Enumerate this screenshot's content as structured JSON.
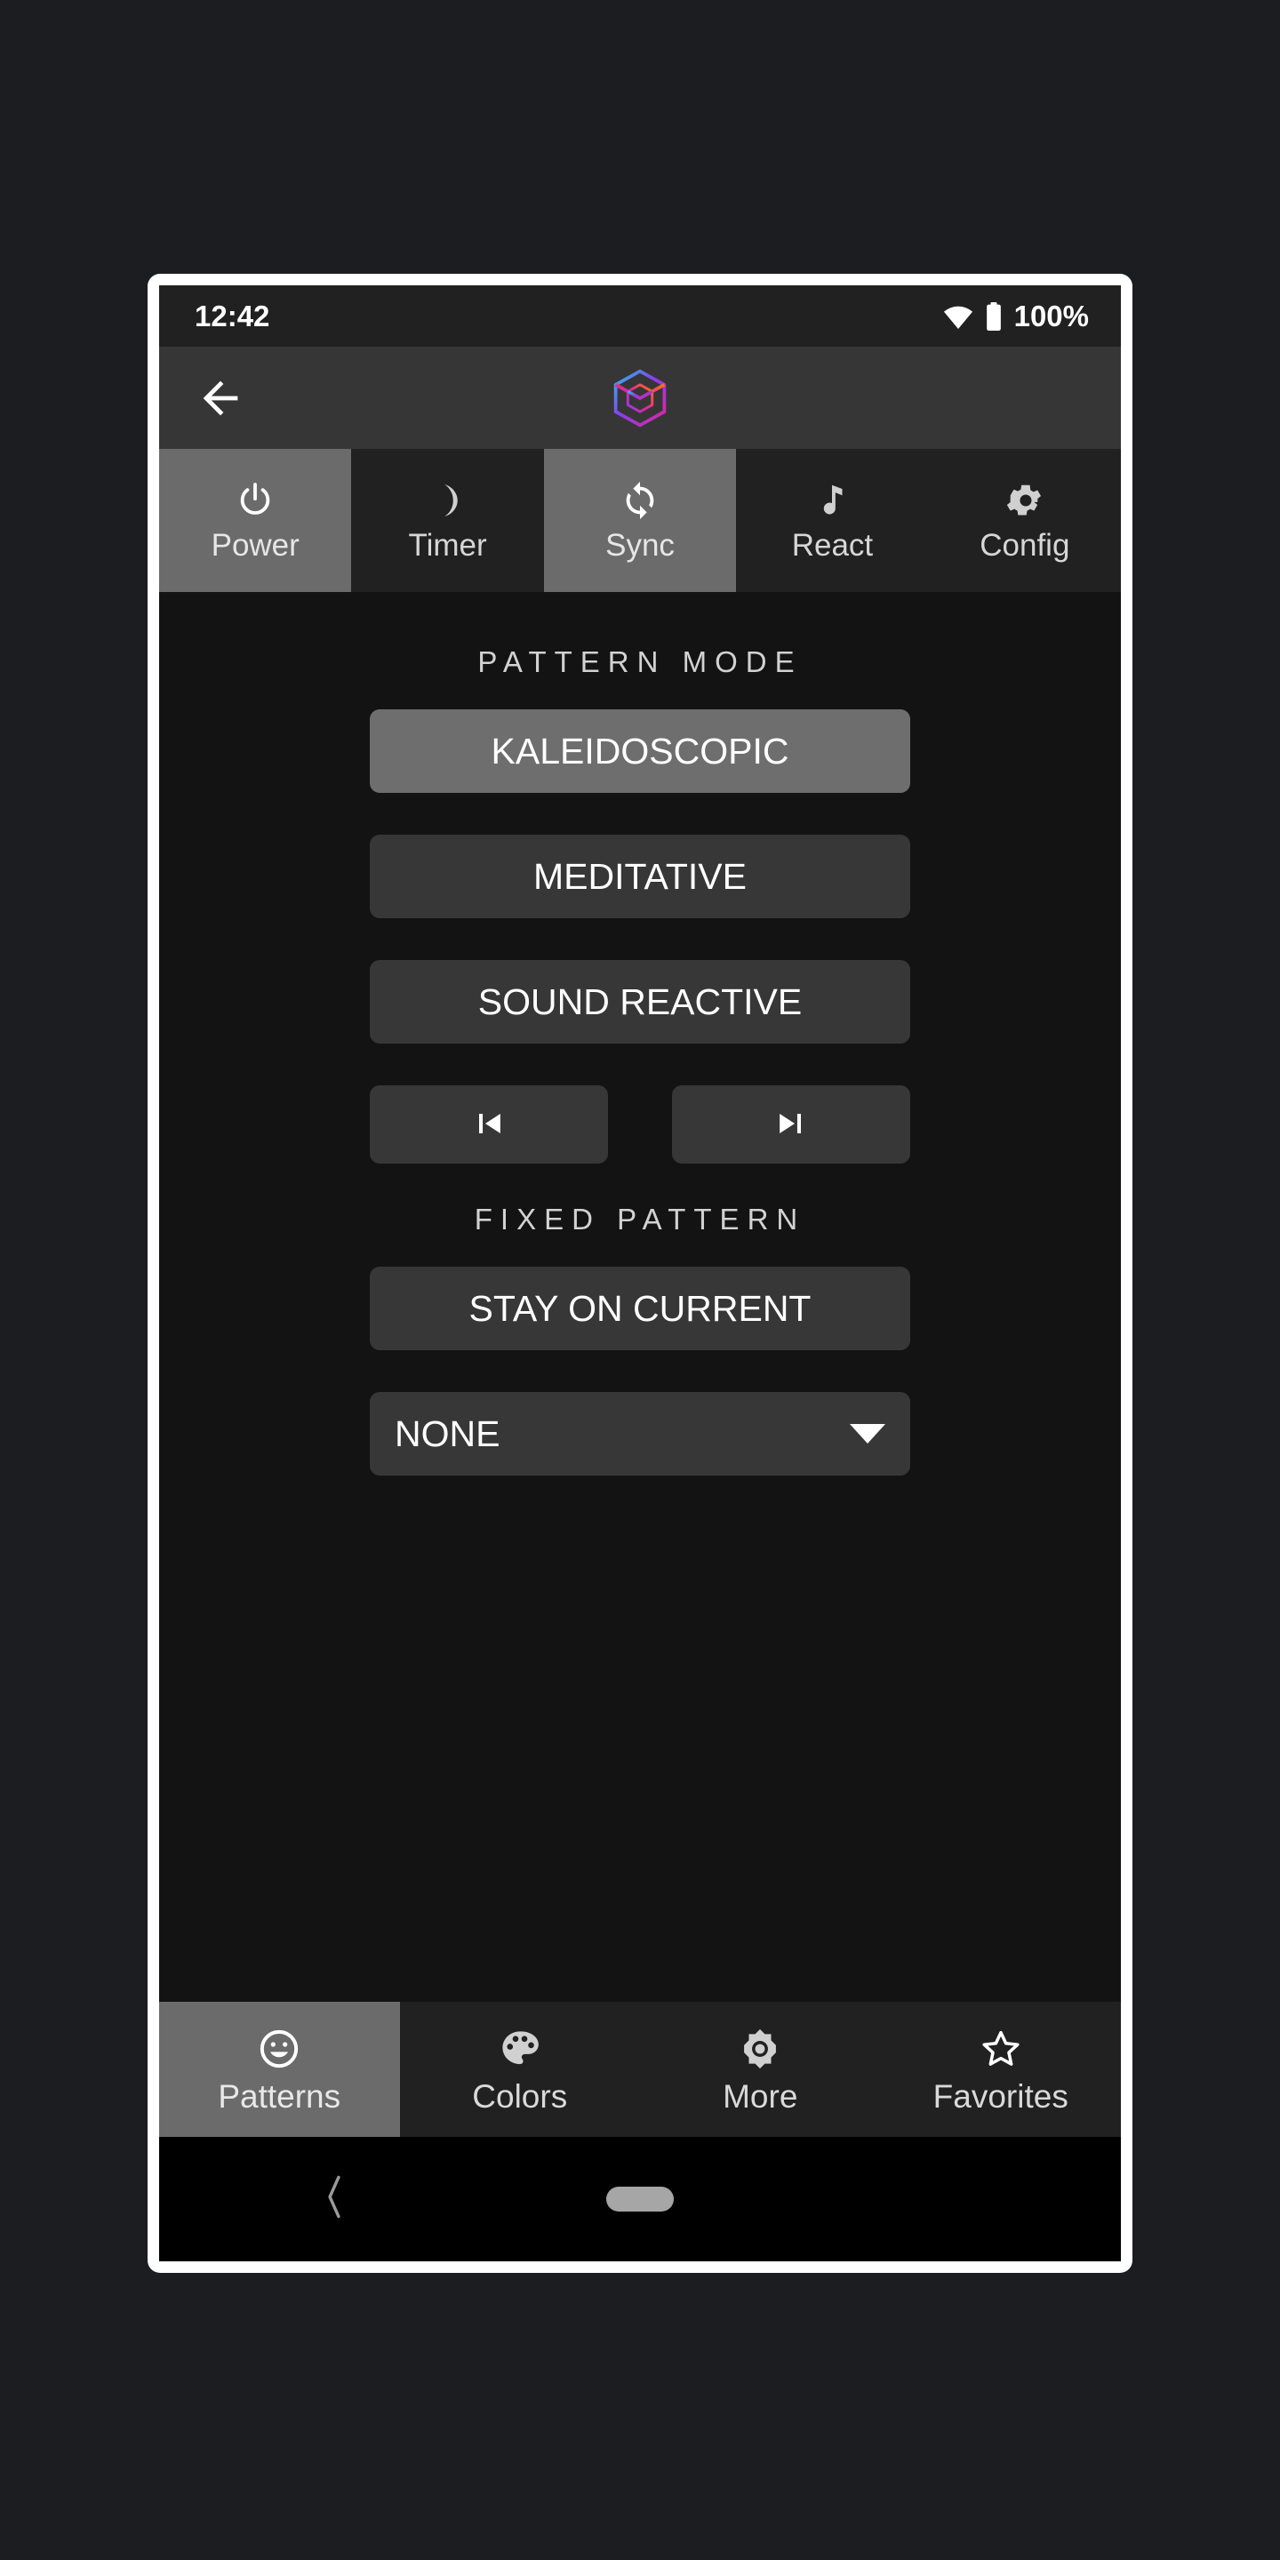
{
  "status_bar": {
    "time": "12:42",
    "battery_percent": "100%",
    "wifi_icon": "wifi-icon",
    "battery_icon": "battery-full-icon"
  },
  "app_bar": {
    "back_icon": "arrow-left-icon",
    "logo_icon": "cube-logo-icon",
    "logo_colors": {
      "cyan": "#22c1e8",
      "orange": "#f97316",
      "magenta": "#e0269b",
      "purple": "#8b3df0"
    }
  },
  "top_tabs": [
    {
      "label": "Power",
      "icon": "power-icon",
      "active": true
    },
    {
      "label": "Timer",
      "icon": "moon-icon",
      "active": false
    },
    {
      "label": "Sync",
      "icon": "refresh-icon",
      "active": true
    },
    {
      "label": "React",
      "icon": "music-note-icon",
      "active": false
    },
    {
      "label": "Config",
      "icon": "gear-icon",
      "active": false
    }
  ],
  "main": {
    "pattern_mode_heading": "PATTERN MODE",
    "pattern_modes": [
      {
        "label": "KALEIDOSCOPIC",
        "selected": true
      },
      {
        "label": "MEDITATIVE",
        "selected": false
      },
      {
        "label": "SOUND REACTIVE",
        "selected": false
      }
    ],
    "nav_buttons": [
      {
        "name": "previous-pattern-button",
        "icon": "skip-previous-icon"
      },
      {
        "name": "next-pattern-button",
        "icon": "skip-next-icon"
      }
    ],
    "fixed_pattern_heading": "FIXED PATTERN",
    "stay_on_current_label": "STAY ON CURRENT",
    "pattern_select": {
      "value": "NONE",
      "caret_icon": "chevron-down-icon"
    }
  },
  "bottom_nav": [
    {
      "label": "Patterns",
      "icon": "smiley-face-icon",
      "active": true
    },
    {
      "label": "Colors",
      "icon": "palette-icon",
      "active": false
    },
    {
      "label": "More",
      "icon": "sun-gear-icon",
      "active": false
    },
    {
      "label": "Favorites",
      "icon": "star-outline-icon",
      "active": false
    }
  ],
  "system_nav": {
    "back_icon": "chevron-left-icon",
    "home_icon": "home-pill-icon"
  },
  "colors": {
    "page_background": "#1c1d20",
    "screen_background": "#131313",
    "app_bar": "#363636",
    "tab_inactive": "#212121",
    "tab_active": "#6b6b6b",
    "button": "#373737",
    "button_selected": "#6e6e6e",
    "text_primary": "#ffffff"
  }
}
